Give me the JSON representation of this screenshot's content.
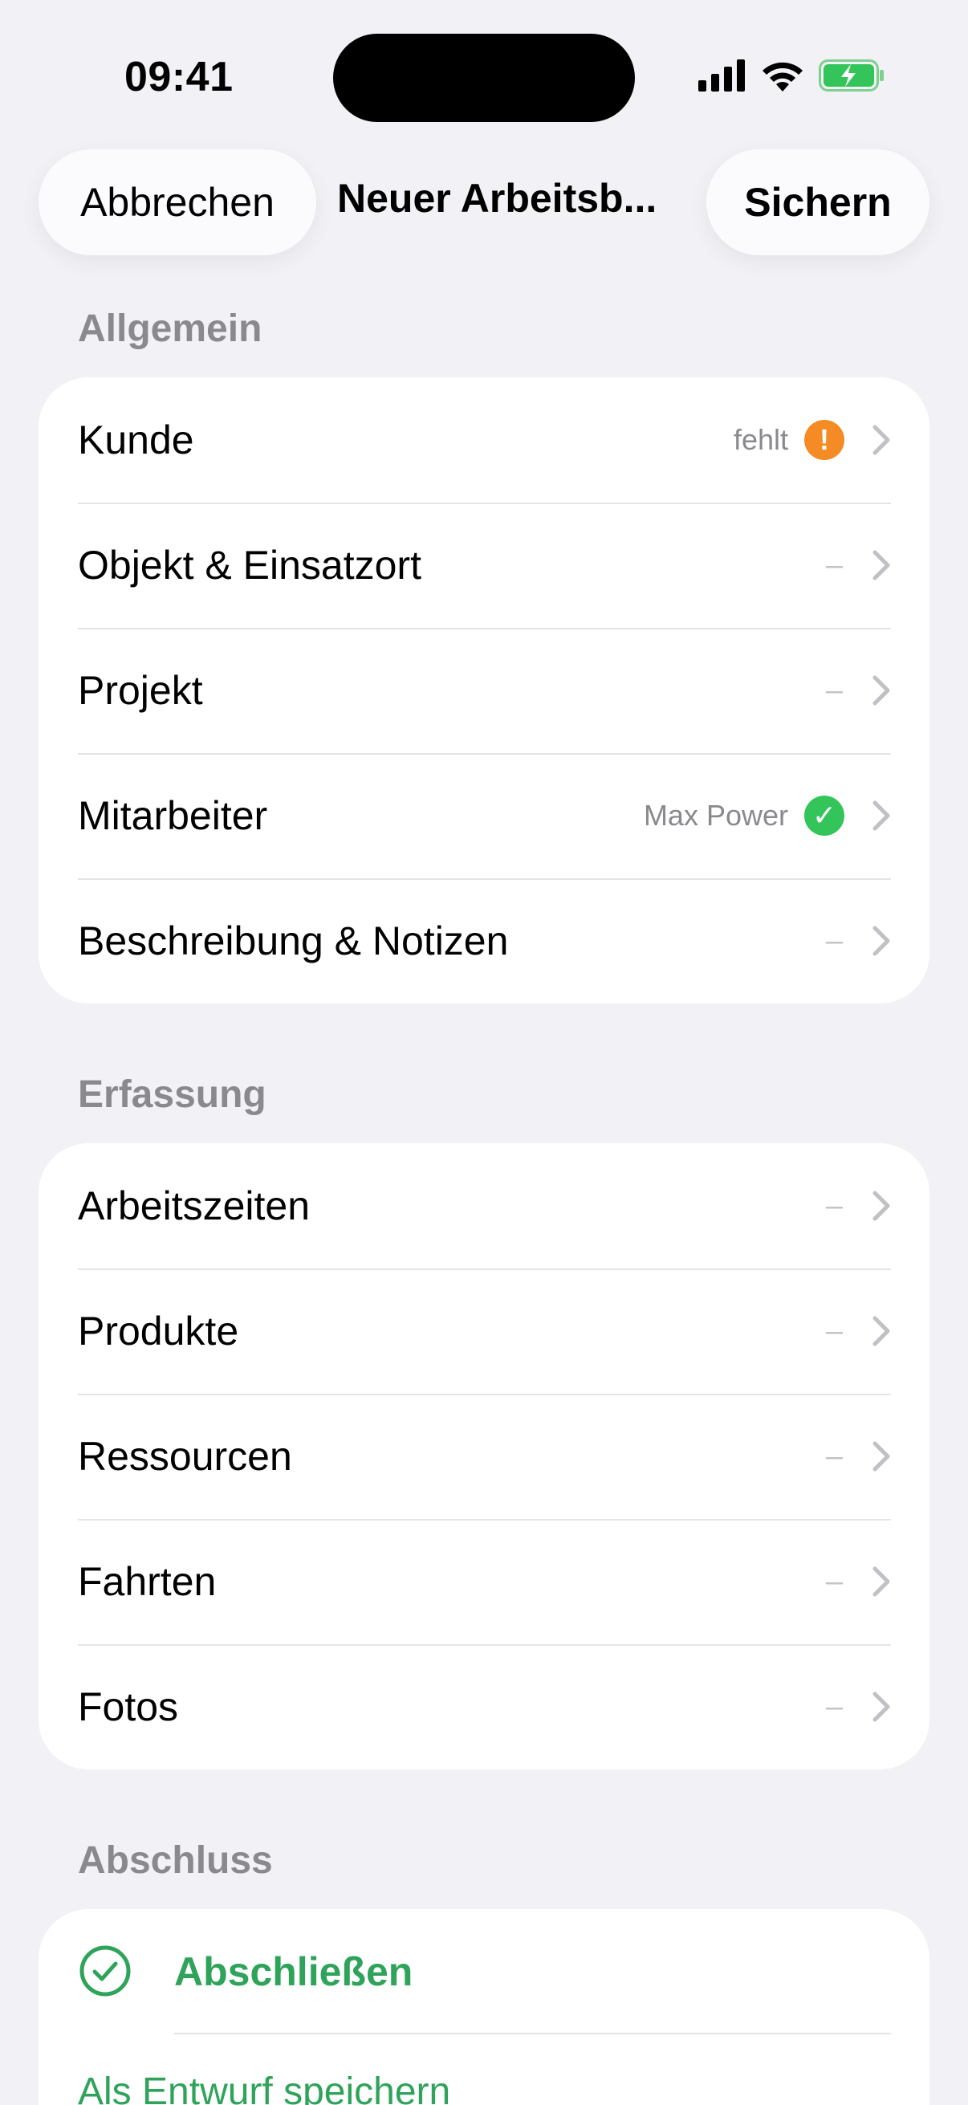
{
  "status_bar": {
    "time": "09:41",
    "icons": [
      "signal-icon",
      "wifi-icon",
      "battery-charging-icon"
    ]
  },
  "nav": {
    "cancel_label": "Abbrechen",
    "title": "Neuer Arbeitsb...",
    "save_label": "Sichern"
  },
  "sections": {
    "general": {
      "header": "Allgemein",
      "rows": [
        {
          "label": "Kunde",
          "value": "fehlt",
          "status": "warning",
          "status_glyph": "!"
        },
        {
          "label": "Objekt & Einsatzort",
          "value": "–"
        },
        {
          "label": "Projekt",
          "value": "–"
        },
        {
          "label": "Mitarbeiter",
          "value": "Max Power",
          "status": "ok",
          "status_glyph": "✓"
        },
        {
          "label": "Beschreibung & Notizen",
          "value": "–"
        }
      ]
    },
    "capture": {
      "header": "Erfassung",
      "rows": [
        {
          "label": "Arbeitszeiten",
          "value": "–"
        },
        {
          "label": "Produkte",
          "value": "–"
        },
        {
          "label": "Ressourcen",
          "value": "–"
        },
        {
          "label": "Fahrten",
          "value": "–"
        },
        {
          "label": "Fotos",
          "value": "–"
        }
      ]
    },
    "finish": {
      "header": "Abschluss",
      "complete_label": "Abschließen",
      "draft_label": "Als Entwurf speichern"
    }
  },
  "colors": {
    "accent_green": "#2fa35a",
    "warning_orange": "#f48b25",
    "ok_green": "#33c55a",
    "background": "#f1f1f6"
  }
}
